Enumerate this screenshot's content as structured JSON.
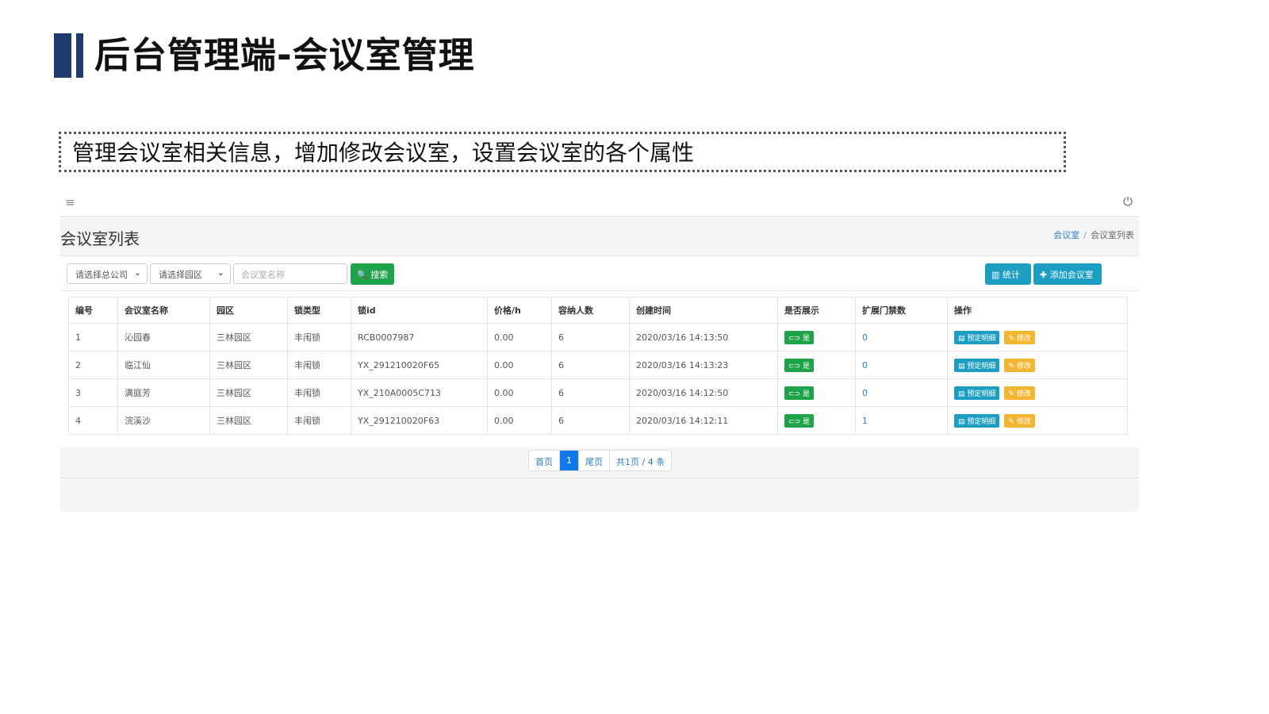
{
  "slide": {
    "title": "后台管理端-会议室管理",
    "description": "管理会议室相关信息，增加修改会议室，设置会议室的各个属性"
  },
  "app": {
    "topbar": {
      "menu_icon": "≡",
      "power_icon": "⏻"
    },
    "page_title": "会议室列表",
    "breadcrumb": {
      "home": "会议室",
      "separator": "/",
      "current": "会议室列表"
    },
    "filters": {
      "company_select": "请选择总公司",
      "park_select": "请选择园区",
      "name_placeholder": "会议室名称",
      "search_label": "搜索",
      "stats_label": "统计",
      "add_label": "添加会议室"
    },
    "table": {
      "headers": [
        "编号",
        "会议室名称",
        "园区",
        "锁类型",
        "锁id",
        "价格/h",
        "容纳人数",
        "创建时间",
        "是否展示",
        "扩展门禁数",
        "操作"
      ],
      "rows": [
        {
          "id": "1",
          "name": "沁园春",
          "park": "三林园区",
          "lock_type": "丰闱锁",
          "lock_id": "RCB0007987",
          "price": "0.00",
          "capacity": "6",
          "created": "2020/03/16 14:13:50",
          "show": "是",
          "ext": "0"
        },
        {
          "id": "2",
          "name": "临江仙",
          "park": "三林园区",
          "lock_type": "丰闱锁",
          "lock_id": "YX_291210020F65",
          "price": "0.00",
          "capacity": "6",
          "created": "2020/03/16 14:13:23",
          "show": "是",
          "ext": "0"
        },
        {
          "id": "3",
          "name": "满庭芳",
          "park": "三林园区",
          "lock_type": "丰闱锁",
          "lock_id": "YX_210A0005C713",
          "price": "0.00",
          "capacity": "6",
          "created": "2020/03/16 14:12:50",
          "show": "是",
          "ext": "0"
        },
        {
          "id": "4",
          "name": "浣溪沙",
          "park": "三林园区",
          "lock_type": "丰闱锁",
          "lock_id": "YX_291210020F63",
          "price": "0.00",
          "capacity": "6",
          "created": "2020/03/16 14:12:11",
          "show": "是",
          "ext": "1"
        }
      ],
      "op_detail": "预定明细",
      "op_edit": "修改"
    },
    "pager": {
      "first": "首页",
      "current": "1",
      "last": "尾页",
      "summary": "共1页 / 4 条"
    }
  },
  "colors": {
    "brand_navy": "#1f3a6e",
    "green": "#1fa34a",
    "teal": "#1b9ec2",
    "yellow": "#f2b632",
    "link_blue": "#2b7fc4"
  }
}
